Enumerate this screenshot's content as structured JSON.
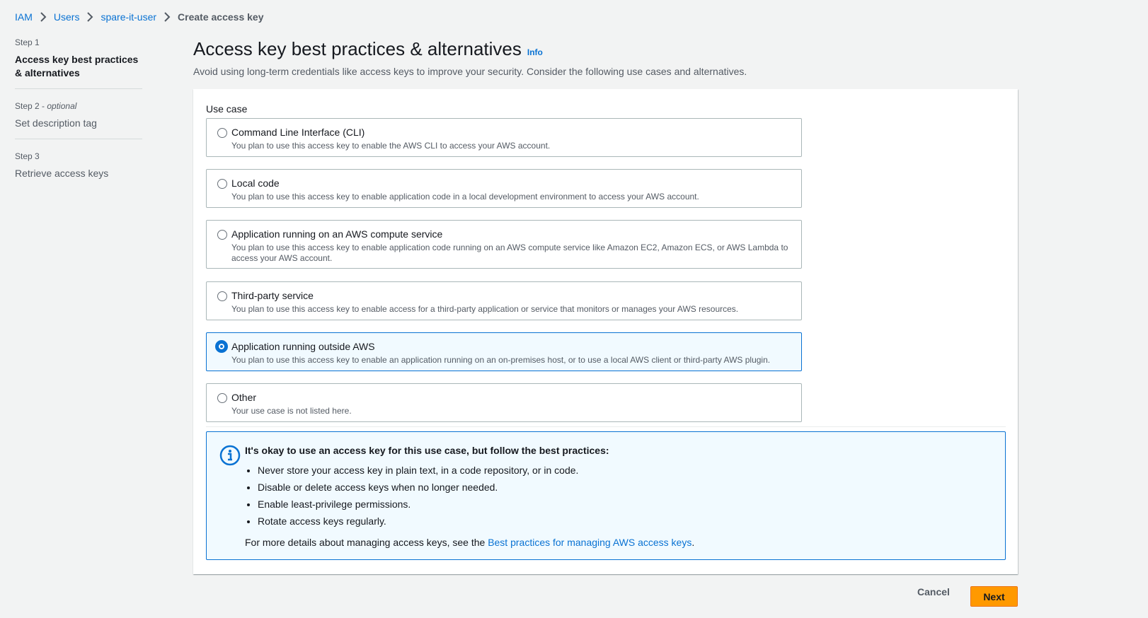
{
  "breadcrumb": {
    "items": [
      "IAM",
      "Users",
      "spare-it-user"
    ],
    "current": "Create access key"
  },
  "steps": [
    {
      "num": "Step 1",
      "title": "Access key best practices & alternatives",
      "active": true
    },
    {
      "num": "Step 2",
      "optional": "optional",
      "title": "Set description tag"
    },
    {
      "num": "Step 3",
      "title": "Retrieve access keys"
    }
  ],
  "header": {
    "title": "Access key best practices & alternatives",
    "info": "Info",
    "description": "Avoid using long-term credentials like access keys to improve your security. Consider the following use cases and alternatives."
  },
  "use_case": {
    "label": "Use case",
    "selected": "Application running outside AWS",
    "options": [
      {
        "title": "Command Line Interface (CLI)",
        "desc": "You plan to use this access key to enable the AWS CLI to access your AWS account."
      },
      {
        "title": "Local code",
        "desc": "You plan to use this access key to enable application code in a local development environment to access your AWS account."
      },
      {
        "title": "Application running on an AWS compute service",
        "desc": "You plan to use this access key to enable application code running on an AWS compute service like Amazon EC2, Amazon ECS, or AWS Lambda to access your AWS account."
      },
      {
        "title": "Third-party service",
        "desc": "You plan to use this access key to enable access for a third-party application or service that monitors or manages your AWS resources."
      },
      {
        "title": "Application running outside AWS",
        "desc": "You plan to use this access key to enable an application running on an on-premises host, or to use a local AWS client or third-party AWS plugin."
      },
      {
        "title": "Other",
        "desc": "Your use case is not listed here."
      }
    ]
  },
  "alert": {
    "title": "It's okay to use an access key for this use case, but follow the best practices:",
    "items": [
      "Never store your access key in plain text, in a code repository, or in code.",
      "Disable or delete access keys when no longer needed.",
      "Enable least-privilege permissions.",
      "Rotate access keys regularly."
    ],
    "footer_prefix": "For more details about managing access keys, see the ",
    "footer_link": "Best practices for managing AWS access keys",
    "footer_suffix": "."
  },
  "actions": {
    "cancel": "Cancel",
    "next": "Next"
  },
  "colors": {
    "link": "#0972d3",
    "primary_button": "#ff9900",
    "selected_bg": "#f1faff"
  }
}
